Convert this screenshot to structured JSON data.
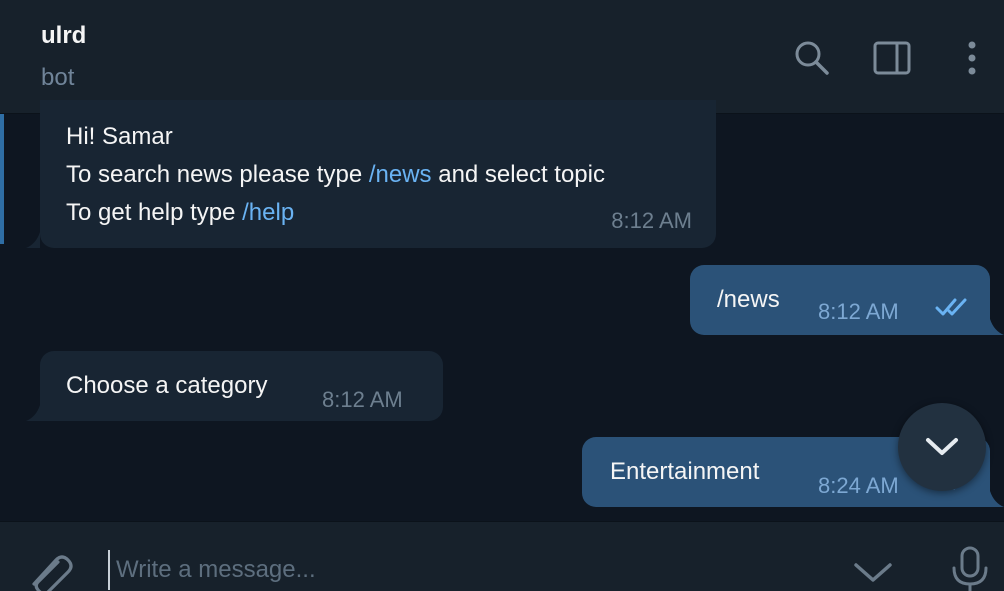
{
  "header": {
    "title": "ulrd",
    "status": "bot",
    "icons": [
      "search-icon",
      "sidebar-toggle-icon",
      "more-vertical-icon"
    ]
  },
  "messages": [
    {
      "direction": "in",
      "lines": [
        {
          "text": "Hi! Samar"
        },
        {
          "before": "To search news please type ",
          "command": "/news",
          "after": " and select topic"
        },
        {
          "before": "To get help type ",
          "command": "/help"
        }
      ],
      "time": "8:12 AM"
    },
    {
      "direction": "out",
      "text": "/news",
      "time": "8:12 AM",
      "read_status": "double-check-icon"
    },
    {
      "direction": "in",
      "text": "Choose a category",
      "time": "8:12 AM"
    },
    {
      "direction": "out",
      "text": "Entertainment",
      "time": "8:24 AM",
      "read_status": "double-check-icon"
    }
  ],
  "composer": {
    "placeholder": "Write a message...",
    "value": ""
  },
  "colors": {
    "background": "#0e1621",
    "header": "#17212b",
    "incoming_bubble": "#182533",
    "outgoing_bubble": "#2b5278",
    "link": "#6ab3f3",
    "muted": "#708499"
  }
}
